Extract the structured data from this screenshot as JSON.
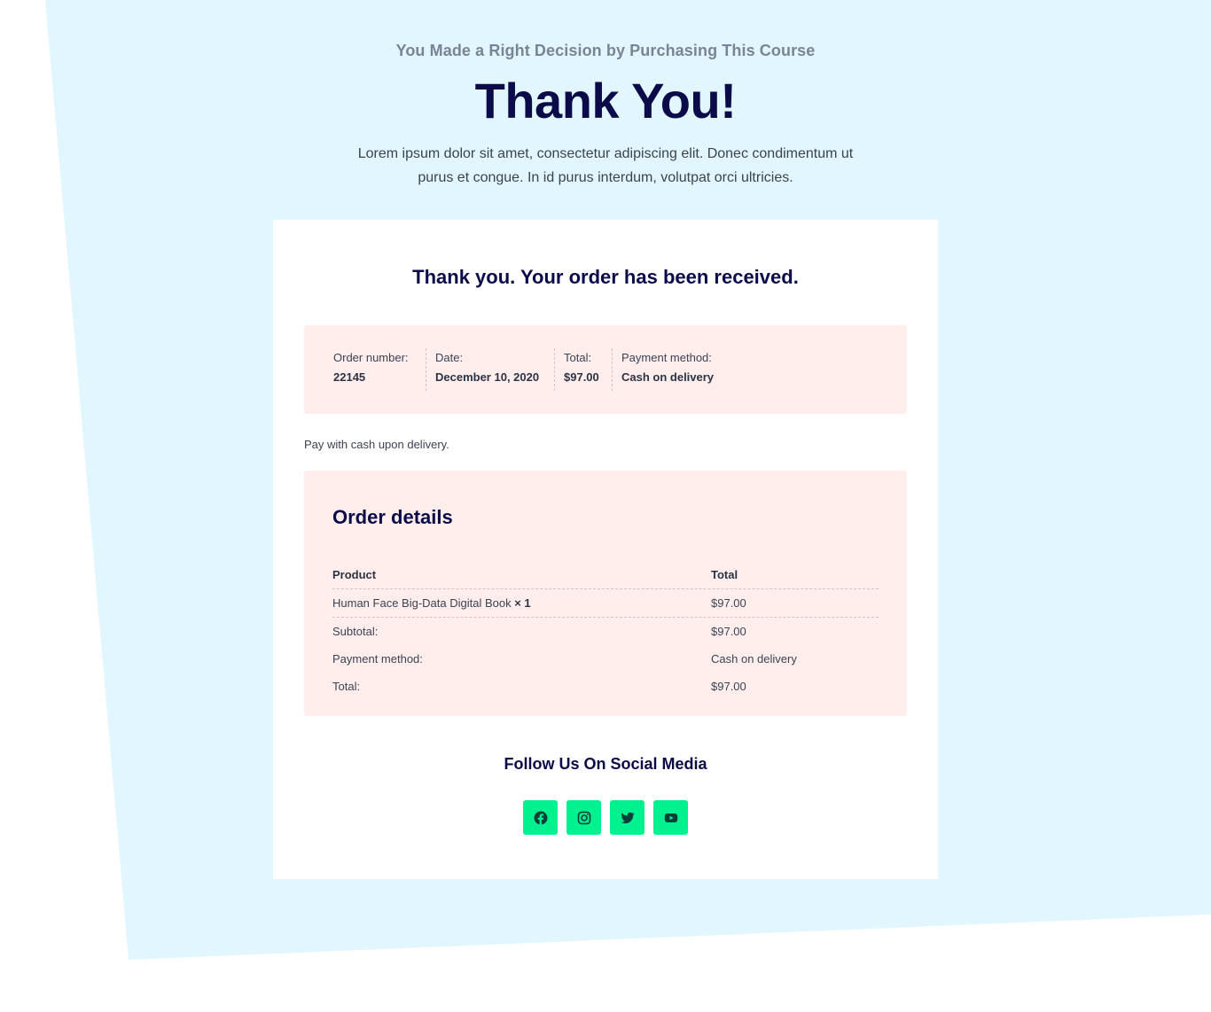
{
  "hero": {
    "kicker": "You Made a Right Decision by Purchasing This Course",
    "title": "Thank You!",
    "description": "Lorem ipsum dolor sit amet, consectetur adipiscing elit. Donec condimentum ut purus et congue. In id purus interdum, volutpat orci ultricies."
  },
  "order": {
    "heading": "Thank you. Your order has been received.",
    "overview": [
      {
        "label": "Order number:",
        "value": "22145"
      },
      {
        "label": "Date:",
        "value": "December 10, 2020"
      },
      {
        "label": "Total:",
        "value": "$97.00"
      },
      {
        "label": "Payment method:",
        "value": "Cash on delivery"
      }
    ],
    "payment_note": "Pay with cash upon delivery.",
    "details": {
      "title": "Order details",
      "headers": {
        "product": "Product",
        "total": "Total"
      },
      "item": {
        "name": "Human Face Big-Data Digital Book",
        "qty": "× 1",
        "total": "$97.00"
      },
      "summary": [
        {
          "label": "Subtotal:",
          "value": "$97.00"
        },
        {
          "label": "Payment method:",
          "value": "Cash on delivery"
        },
        {
          "label": "Total:",
          "value": "$97.00"
        }
      ]
    }
  },
  "social": {
    "title": "Follow Us On Social Media",
    "icons": [
      "facebook-icon",
      "instagram-icon",
      "twitter-icon",
      "youtube-icon"
    ]
  },
  "colors": {
    "background_shape": "#e2f7fd",
    "heading": "#0b0b4a",
    "panel": "#ffeeeb",
    "social_button": "#00f28e"
  }
}
